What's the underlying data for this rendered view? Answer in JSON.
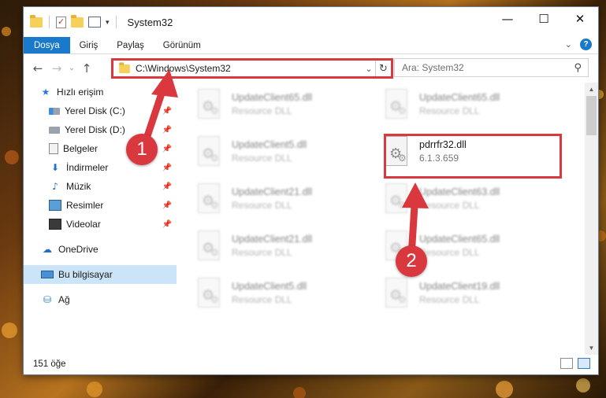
{
  "window": {
    "title": "System32",
    "controls": {
      "minimize": "—",
      "maximize": "☐",
      "close": "✕"
    }
  },
  "ribbon": {
    "tabs": [
      "Dosya",
      "Giriş",
      "Paylaş",
      "Görünüm"
    ],
    "help": "?"
  },
  "navbar": {
    "address": "C:\\Windows\\System32",
    "search_placeholder": "Ara: System32"
  },
  "sidebar": {
    "items": [
      {
        "label": "Hızlı erişim",
        "icon": "star-icon"
      },
      {
        "label": "Yerel Disk (C:)",
        "icon": "drive-icon"
      },
      {
        "label": "Yerel Disk (D:)",
        "icon": "drive-icon"
      },
      {
        "label": "Belgeler",
        "icon": "documents-icon"
      },
      {
        "label": "İndirmeler",
        "icon": "downloads-icon"
      },
      {
        "label": "Müzik",
        "icon": "music-icon"
      },
      {
        "label": "Resimler",
        "icon": "pictures-icon"
      },
      {
        "label": "Videolar",
        "icon": "videos-icon"
      },
      {
        "label": "OneDrive",
        "icon": "cloud-icon"
      },
      {
        "label": "Bu bilgisayar",
        "icon": "computer-icon"
      },
      {
        "label": "Ağ",
        "icon": "network-icon"
      }
    ]
  },
  "files": [
    {
      "name": "UpdateClient65.dll",
      "sub": "Resource DLL"
    },
    {
      "name": "UpdateClient65.dll",
      "sub": "Resource DLL"
    },
    {
      "name": "UpdateClient5.dll",
      "sub": "Resource DLL"
    },
    {
      "name": "pdrrfr32.dll",
      "sub": "6.1.3.659"
    },
    {
      "name": "UpdateClient21.dll",
      "sub": "Resource DLL"
    },
    {
      "name": "UpdateClient63.dll",
      "sub": "Resource DLL"
    },
    {
      "name": "UpdateClient21.dll",
      "sub": "Resource DLL"
    },
    {
      "name": "UpdateClient65.dll",
      "sub": "Resource DLL"
    },
    {
      "name": "UpdateClient5.dll",
      "sub": "Resource DLL"
    },
    {
      "name": "UpdateClient19.dll",
      "sub": "Resource DLL"
    }
  ],
  "status": {
    "count": "151 öğe"
  },
  "annotations": {
    "step1": "1",
    "step2": "2",
    "color": "#d9383f"
  }
}
